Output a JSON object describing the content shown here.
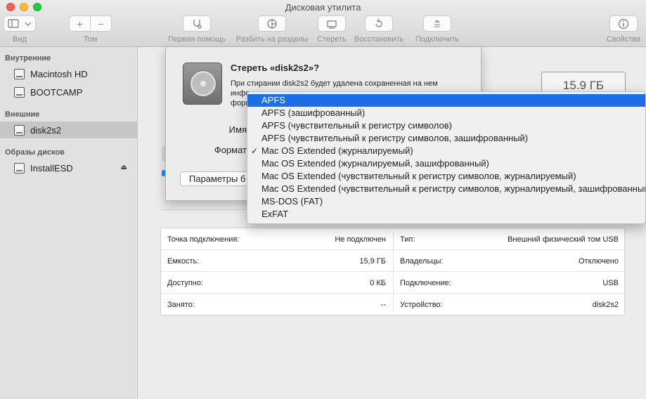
{
  "window": {
    "title": "Дисковая утилита"
  },
  "toolbar": {
    "view_label": "Вид",
    "volume_label": "Том",
    "first_aid_label": "Первая помощь",
    "partition_label": "Разбить на разделы",
    "erase_label": "Стереть",
    "restore_label": "Восстановить",
    "mount_label": "Подключить",
    "info_label": "Свойства",
    "add_glyph": "+",
    "remove_glyph": "−"
  },
  "sidebar": {
    "internal_header": "Внутренние",
    "external_header": "Внешние",
    "images_header": "Образы дисков",
    "internal": [
      {
        "label": "Macintosh HD"
      },
      {
        "label": "BOOTCAMP"
      }
    ],
    "external": [
      {
        "label": "disk2s2",
        "selected": true
      }
    ],
    "images": [
      {
        "label": "InstallESD"
      }
    ]
  },
  "capacity_box": {
    "value": "15.9 ГБ"
  },
  "sheet": {
    "title": "Стереть «disk2s2»?",
    "text_line1": "При стирании disk2s2 будет удалена сохраненная на нем",
    "text_line2": "инфо",
    "text_line3": "форм",
    "name_label": "Имя",
    "format_label": "Формат",
    "security_button": "Параметры б"
  },
  "format_menu": {
    "items": [
      {
        "label": "APFS",
        "highlighted": true,
        "checked": false
      },
      {
        "label": "APFS (зашифрованный)",
        "highlighted": false,
        "checked": false
      },
      {
        "label": "APFS (чувствительный к регистру символов)",
        "highlighted": false,
        "checked": false
      },
      {
        "label": "APFS (чувствительный к регистру символов, зашифрованный)",
        "highlighted": false,
        "checked": false
      },
      {
        "label": "Mac OS Extended (журналируемый)",
        "highlighted": false,
        "checked": true
      },
      {
        "label": "Mac OS Extended (журналируемый, зашифрованный)",
        "highlighted": false,
        "checked": false
      },
      {
        "label": "Mac OS Extended (чувствительный к регистру символов, журналируемый)",
        "highlighted": false,
        "checked": false
      },
      {
        "label": "Mac OS Extended (чувствительный к регистру символов, журналируемый, зашифрованный)",
        "highlighted": false,
        "checked": false
      },
      {
        "label": "MS-DOS (FAT)",
        "highlighted": false,
        "checked": false
      },
      {
        "label": "ExFAT",
        "highlighted": false,
        "checked": false
      }
    ],
    "check_glyph": "✓"
  },
  "info": {
    "rows": [
      {
        "left_key": "Точка подключения:",
        "left_val": "Не подключен",
        "right_key": "Тип:",
        "right_val": "Внешний физический том USB"
      },
      {
        "left_key": "Емкость:",
        "left_val": "15,9 ГБ",
        "right_key": "Владельцы:",
        "right_val": "Отключено"
      },
      {
        "left_key": "Доступно:",
        "left_val": "0 КБ",
        "right_key": "Подключение:",
        "right_val": "USB"
      },
      {
        "left_key": "Занято:",
        "left_val": "--",
        "right_key": "Устройство:",
        "right_val": "disk2s2"
      }
    ]
  },
  "colors": {
    "accent": "#1c6ee6",
    "sidebar_bg": "#e2e1e1",
    "selected_row": "#c7c6c6"
  },
  "icons": [
    "sidebar-toggle-icon",
    "stethoscope-icon",
    "pie-chart-icon",
    "eraser-icon",
    "restore-icon",
    "mount-icon",
    "info-icon",
    "disk-icon",
    "eject-icon",
    "hard-drive-icon"
  ]
}
